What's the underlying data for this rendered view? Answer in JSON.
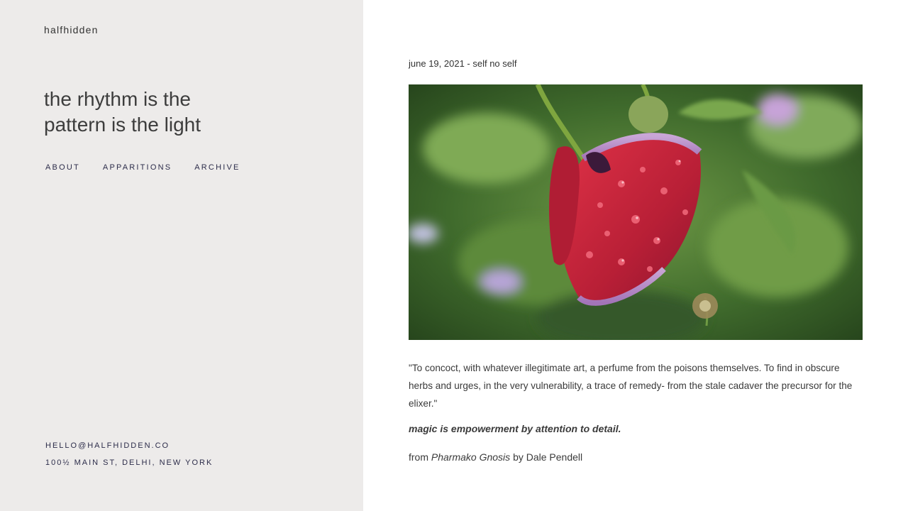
{
  "site": {
    "name": "halfhidden",
    "tagline": [
      "the rhythm is the",
      "pattern is the light"
    ]
  },
  "nav": {
    "about": "ABOUT",
    "apparitions": "APPARITIONS",
    "archive": "ARCHIVE"
  },
  "contact": {
    "email": "HELLO@HALFHIDDEN.CO",
    "address": "100½ MAIN ST, DELHI, NEW YORK"
  },
  "post": {
    "title": "june 19, 2021 - self no self",
    "image_icon": "red-poppy-with-raindrops",
    "quote": "\"To concoct, with whatever illegitimate art, a perfume from the poisons themselves. To find in obscure herbs and urges, in the very vulnerability, a trace of remedy- from the stale cadaver the precursor for the elixer.\"",
    "motto": "magic is empowerment by attention to detail.",
    "source_prefix": "from",
    "source_book": "Pharmako Gnosis",
    "source_author": "by Dale Pendell"
  },
  "colors": {
    "sidebar_bg": "#edebea",
    "nav_text": "#2c2c4a",
    "poppy_red": "#c8243a"
  }
}
